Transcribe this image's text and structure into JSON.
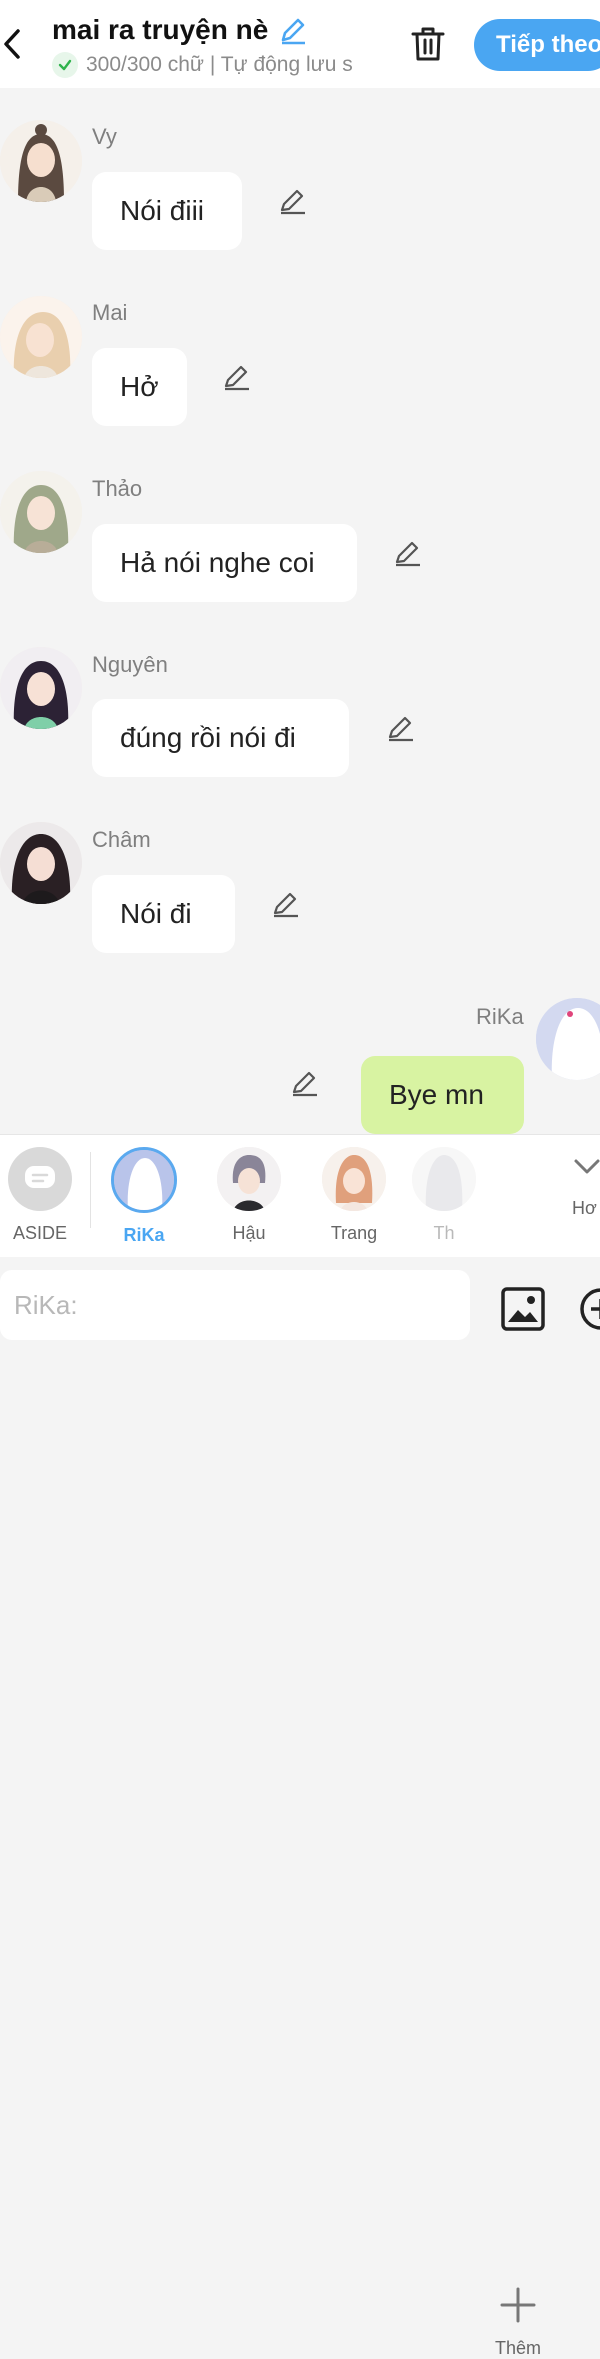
{
  "header": {
    "title": "mai ra truyện nè",
    "status": "300/300 chữ | Tự động lưu s",
    "next_label": "Tiếp theo"
  },
  "messages": [
    {
      "name": "Vy",
      "text": "Nói điii"
    },
    {
      "name": "Mai",
      "text": "Hở"
    },
    {
      "name": "Thảo",
      "text": "Hả nói nghe coi"
    },
    {
      "name": "Nguyên",
      "text": "đúng rồi nói đi"
    },
    {
      "name": "Châm",
      "text": "Nói đi"
    },
    {
      "name": "RiKa",
      "text": "Bye mn"
    }
  ],
  "characters": [
    {
      "label": "ASIDE"
    },
    {
      "label": "RiKa",
      "selected": true
    },
    {
      "label": "Hậu"
    },
    {
      "label": "Trang"
    },
    {
      "label": "Th"
    }
  ],
  "add_label": "Thêm",
  "more_label": "Hơ",
  "input": {
    "placeholder": "RiKa:"
  },
  "colors": {
    "accent": "#4aa6f2",
    "my_bubble": "#d8f3a2",
    "background": "#f4f4f4"
  },
  "icons": [
    "back-icon",
    "pencil-icon",
    "check-icon",
    "trash-icon",
    "plus-icon",
    "chevron-down-icon",
    "image-icon",
    "add-circle-icon"
  ]
}
